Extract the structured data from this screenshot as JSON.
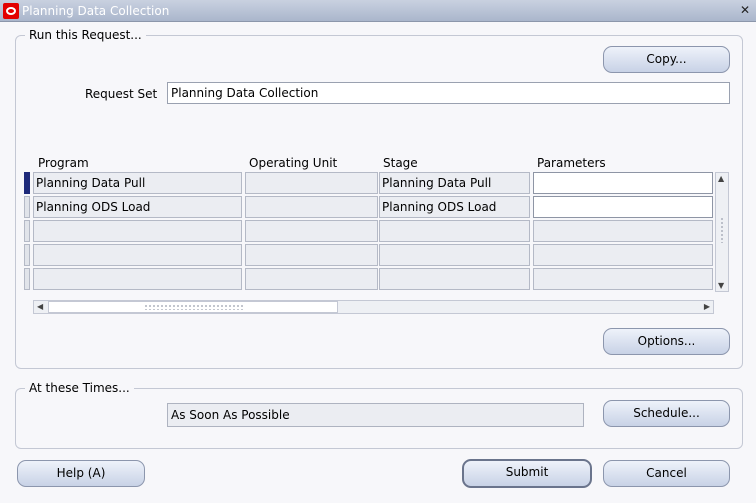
{
  "window": {
    "title": "Planning Data Collection"
  },
  "run_group": {
    "label": "Run this Request...",
    "copy_button": "Copy...",
    "request_set_label": "Request Set",
    "request_set_value": "Planning Data Collection",
    "columns": [
      "Program",
      "Operating Unit",
      "Stage",
      "Parameters"
    ],
    "rows": [
      {
        "program": "Planning Data Pull",
        "operating_unit": "",
        "stage": "Planning Data Pull",
        "parameters": ""
      },
      {
        "program": "Planning ODS Load",
        "operating_unit": "",
        "stage": "Planning ODS Load",
        "parameters": ""
      },
      {
        "program": "",
        "operating_unit": "",
        "stage": "",
        "parameters": ""
      },
      {
        "program": "",
        "operating_unit": "",
        "stage": "",
        "parameters": ""
      },
      {
        "program": "",
        "operating_unit": "",
        "stage": "",
        "parameters": ""
      }
    ],
    "options_button": "Options..."
  },
  "times_group": {
    "label": "At these Times...",
    "schedule_value": "As Soon As Possible",
    "schedule_button": "Schedule..."
  },
  "footer": {
    "help_button": "Help (A)",
    "submit_button": "Submit",
    "cancel_button": "Cancel"
  },
  "icons": {
    "window_logo": "oracle-logo-icon",
    "close": "close-icon"
  },
  "colors": {
    "titlebar": "#b8c3d6",
    "button": "#d8e0ee",
    "current_row": "#1e2a7a"
  }
}
